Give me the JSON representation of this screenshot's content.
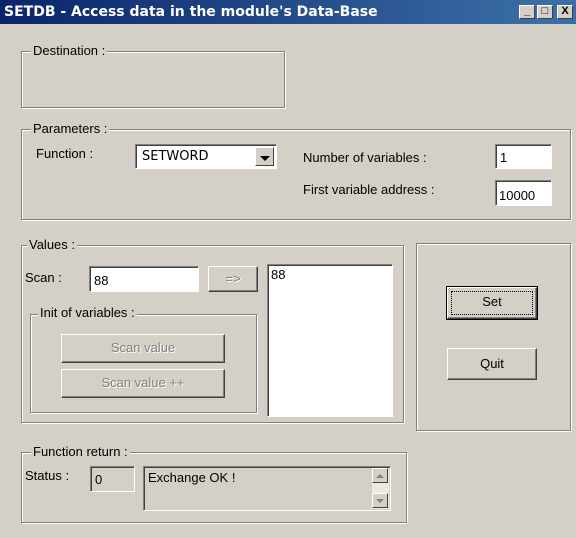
{
  "window": {
    "title": "SETDB - Access data in the module's Data-Base",
    "minimize_glyph": "_",
    "maximize_glyph": "□",
    "close_glyph": "X"
  },
  "destination": {
    "legend": "Destination :"
  },
  "parameters": {
    "legend": "Parameters :",
    "function_label": "Function :",
    "function_value": "SETWORD",
    "num_vars_label": "Number of variables :",
    "num_vars_value": "1",
    "first_addr_label": "First variable address :",
    "first_addr_value": "10000"
  },
  "values": {
    "legend": "Values :",
    "scan_label": "Scan :",
    "scan_value": "88",
    "arrow_button": "=>",
    "list_items": [
      "88"
    ],
    "init_legend": "Init of variables :",
    "scan_value_button": "Scan value",
    "scan_value_pp_button": "Scan value ++"
  },
  "actions": {
    "set": "Set",
    "quit": "Quit"
  },
  "function_return": {
    "legend": "Function return :",
    "status_label": "Status :",
    "status_value": "0",
    "message": "Exchange OK !"
  },
  "icons": {
    "dropdown": "chevron-down-icon",
    "scroll_up": "scroll-up-icon",
    "scroll_down": "scroll-down-icon"
  }
}
